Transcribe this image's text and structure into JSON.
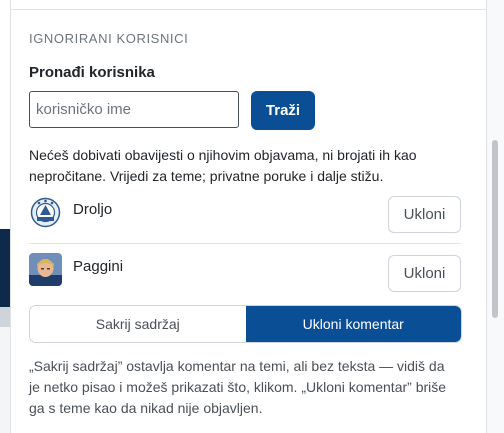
{
  "section": {
    "title": "IGNORIRANI KORISNICI",
    "find_label": "Pronađi korisnika",
    "search_placeholder": "korisničko ime",
    "search_button": "Traži",
    "help_text": "Nećeš dobivati obavijesti o njihovim objavama, ni brojati ih kao nepročitane. Vrijedi za teme; privatne poruke i dalje stižu."
  },
  "users": [
    {
      "name": "Droljo",
      "remove_label": "Ukloni",
      "avatar_icon": "club-crest-avatar"
    },
    {
      "name": "Paggini",
      "remove_label": "Ukloni",
      "avatar_icon": "photo-avatar"
    }
  ],
  "mode": {
    "options": [
      "Sakrij sadržaj",
      "Ukloni komentar"
    ],
    "selected": "Ukloni komentar",
    "explanation": "„Sakrij sadržaj” ostavlja komentar na temi, ali bez teksta — vidiš da je netko pisao i možeš prikazati što, klikom. „Ukloni komentar” briše ga s teme kao da nikad nije objavljen."
  },
  "colors": {
    "accent": "#0a4f96",
    "text": "#212529",
    "muted": "#6c757d",
    "border": "#ced4da"
  }
}
